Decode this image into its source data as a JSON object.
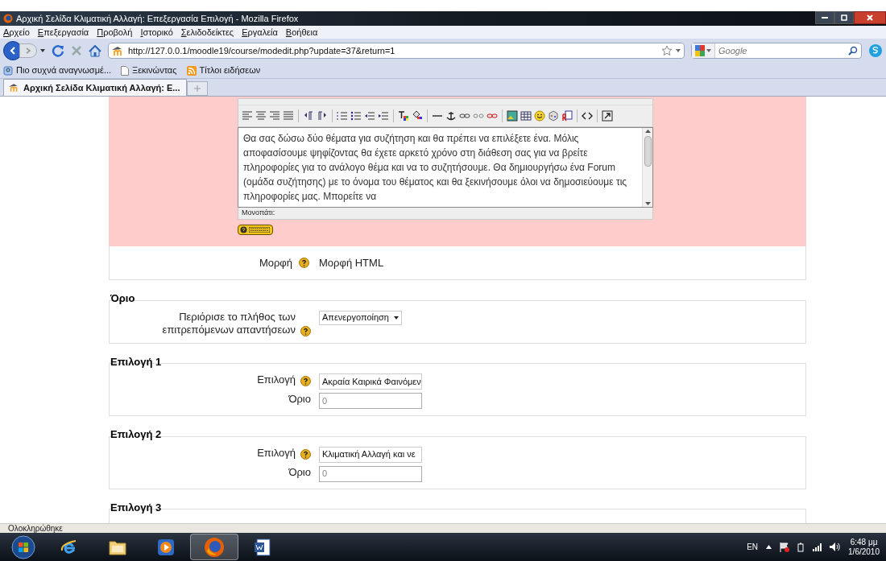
{
  "window": {
    "title": "Αρχική Σελίδα Κλιματική Αλλαγή: Επεξεργασία Επιλογή - Mozilla Firefox"
  },
  "menu": [
    "Αρχείο",
    "Επεξεργασία",
    "Προβολή",
    "Ιστορικό",
    "Σελιδοδείκτες",
    "Εργαλεία",
    "Βοήθεια"
  ],
  "address": {
    "url": "http://127.0.0.1/moodle19/course/modedit.php?update=37&return=1"
  },
  "search": {
    "placeholder": "Google"
  },
  "bookmarks": [
    {
      "label": "Πιο συχνά αναγνωσμέ...",
      "kind": "smart"
    },
    {
      "label": "Ξεκινώντας",
      "kind": "page"
    },
    {
      "label": "Τίτλοι ειδήσεων",
      "kind": "feed"
    }
  ],
  "tabs": [
    {
      "label": "Αρχική Σελίδα Κλιματική Αλλαγή: Ε...",
      "selected": true
    }
  ],
  "editor": {
    "text": "Θα σας δώσω δύο θέματα για συζήτηση και θα πρέπει να επιλέξετε ένα. Μόλις αποφασίσουμε ψηφίζοντας θα έχετε αρκετό χρόνο στη διάθεση σας για να βρείτε πληροφορίες για το ανάλογο θέμα και να το συζητήσουμε. Θα δημιουργήσω ένα Forum (ομάδα συζήτησης) με το όνομα του θέματος και θα ξεκινήσουμε όλοι να δημοσιεύουμε τις πληροφορίες μας. Μπορείτε να",
    "path_label": "Μονοπάτι:"
  },
  "format": {
    "label": "Μορφή",
    "value": "Μορφή HTML"
  },
  "sections": [
    {
      "legend": "Όριο",
      "fields": [
        {
          "kind": "select",
          "label": "Περιόρισε το πλήθος των επιτρεπόμενων απαντήσεων",
          "help": true,
          "value": "Απενεργοποίηση"
        }
      ]
    },
    {
      "legend": "Επιλογή 1",
      "fields": [
        {
          "kind": "text",
          "label": "Επιλογή",
          "help": true,
          "value": "Ακραία Καιρικά Φαινόμεν"
        },
        {
          "kind": "number",
          "label": "Όριο",
          "help": false,
          "value": "0",
          "disabled": true
        }
      ]
    },
    {
      "legend": "Επιλογή 2",
      "fields": [
        {
          "kind": "text",
          "label": "Επιλογή",
          "help": true,
          "value": "Κλιματική Αλλαγή και νε"
        },
        {
          "kind": "number",
          "label": "Όριο",
          "help": false,
          "value": "0",
          "disabled": true
        }
      ]
    },
    {
      "legend": "Επιλογή 3"
    }
  ],
  "status_bar": "Ολοκληρώθηκε",
  "taskbar": [
    {
      "kind": "ie",
      "selected": false
    },
    {
      "kind": "folder",
      "selected": false
    },
    {
      "kind": "media",
      "selected": false
    },
    {
      "kind": "firefox",
      "selected": true
    },
    {
      "kind": "word",
      "selected": false
    }
  ],
  "tray": {
    "language": "EN",
    "time": "6:48 μμ",
    "date": "1/6/2010"
  }
}
